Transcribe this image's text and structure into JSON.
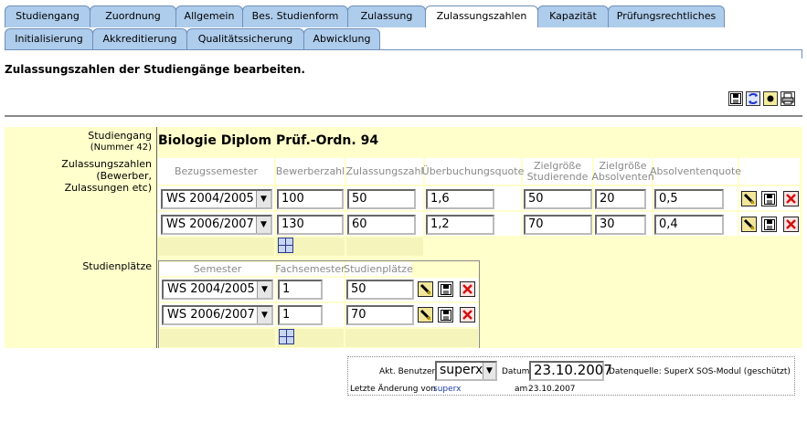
{
  "tabs_row1": [
    {
      "label": "Studiengang",
      "active": false
    },
    {
      "label": "Zuordnung",
      "active": false
    },
    {
      "label": "Allgemein",
      "active": false
    },
    {
      "label": "Bes. Studienform",
      "active": false
    },
    {
      "label": "Zulassung",
      "active": false
    },
    {
      "label": "Zulassungszahlen",
      "active": true
    },
    {
      "label": "Kapazität",
      "active": false
    },
    {
      "label": "Prüfungsrechtliches",
      "active": false
    }
  ],
  "tabs_row2": [
    {
      "label": "Initialisierung"
    },
    {
      "label": "Akkreditierung"
    },
    {
      "label": "Qualitätssicherung"
    },
    {
      "label": "Abwicklung"
    }
  ],
  "page_title": "Zulassungszahlen der Studiengänge bearbeiten.",
  "labels": {
    "studiengang": "Studiengang",
    "nummer": "(Nummer 42)",
    "zulassungszahlen_1": "Zulassungszahlen (Bewerber,",
    "zulassungszahlen_2": "Zulassungen etc)",
    "studienplaetze": "Studienplätze"
  },
  "studiengang_name": "Biologie Diplom Prüf.-Ordn. 94",
  "zz_table": {
    "headers": {
      "bezugssemester": "Bezugssemester",
      "bewerberzahl": "Bewerberzahl",
      "zulassungszahl": "Zulassungszahl",
      "ueberbuchungsquote": "Überbuchungsquote",
      "zielgroesse_stud_1": "Zielgröße",
      "zielgroesse_stud_2": "Studierende",
      "zielgroesse_abs_1": "Zielgröße",
      "zielgroesse_abs_2": "Absolventen",
      "absolventenquote": "Absolventenquote"
    },
    "rows": [
      {
        "semester": "WS 2004/2005",
        "bewerber": "100",
        "zulassung": "50",
        "ueberbuchung": "1,6",
        "ziel_stud": "50",
        "ziel_abs": "20",
        "abs_quote": "0,5"
      },
      {
        "semester": "WS 2006/2007",
        "bewerber": "130",
        "zulassung": "60",
        "ueberbuchung": "1,2",
        "ziel_stud": "70",
        "ziel_abs": "30",
        "abs_quote": "0,4"
      }
    ]
  },
  "sp_table": {
    "headers": {
      "semester": "Semester",
      "fachsemester": "Fachsemester",
      "studienplaetze": "Studienplätze"
    },
    "rows": [
      {
        "semester": "WS 2004/2005",
        "fachsemester": "1",
        "plaetze": "50"
      },
      {
        "semester": "WS 2006/2007",
        "fachsemester": "1",
        "plaetze": "70"
      }
    ]
  },
  "footer": {
    "akt_benutzer_label": "Akt. Benutzer",
    "benutzer": "superx",
    "datum_label": "Datum",
    "datum": "23.10.2007",
    "datenquelle": "Datenquelle: SuperX SOS-Modul (geschützt)",
    "letzte_aenderung_label": "Letzte Änderung von",
    "letzte_aenderung_user": "superx",
    "am_label": "am",
    "am_datum": "23.10.2007"
  },
  "colors": {
    "tab": "#aeccec",
    "panel": "#ffffcc",
    "header_text": "#8a8a8a"
  },
  "icons": {
    "toolbar": [
      "save-icon",
      "reload-icon",
      "record-icon",
      "print-icon"
    ],
    "row": [
      "edit-icon",
      "save-icon",
      "delete-icon"
    ],
    "add": "add-row-icon"
  }
}
